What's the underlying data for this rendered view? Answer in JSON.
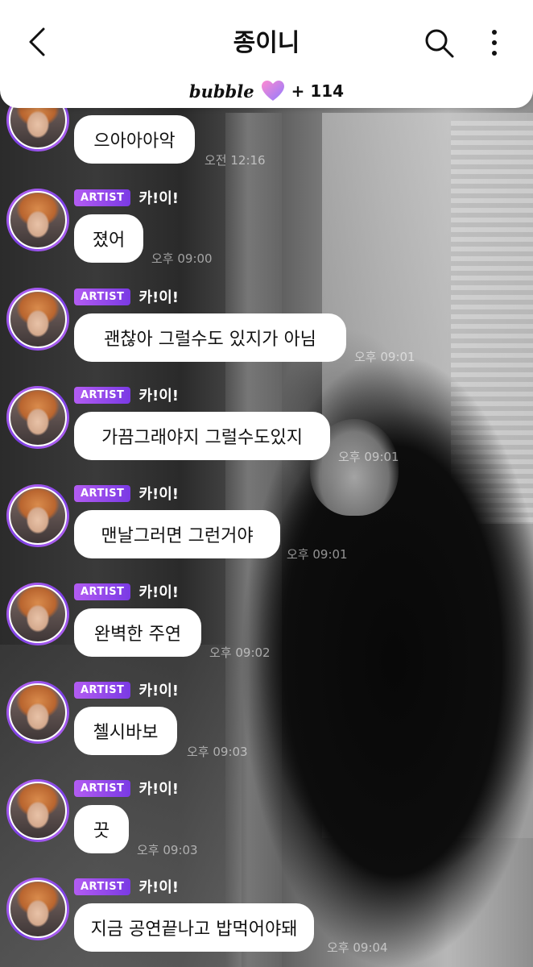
{
  "header": {
    "title": "종이니",
    "bubble_logo": "bubble",
    "bubble_count": "+ 114"
  },
  "messages": [
    {
      "badge": "",
      "name": "",
      "text": "으아아아악",
      "time": "오전 12:16"
    },
    {
      "badge": "ARTIST",
      "name": "카!이!",
      "text": "졌어",
      "time": "오후 09:00"
    },
    {
      "badge": "ARTIST",
      "name": "카!이!",
      "text": "괜찮아 그럴수도 있지가 아님",
      "time": "오후 09:01"
    },
    {
      "badge": "ARTIST",
      "name": "카!이!",
      "text": "가끔그래야지 그럴수도있지",
      "time": "오후 09:01"
    },
    {
      "badge": "ARTIST",
      "name": "카!이!",
      "text": "맨날그러면 그런거야",
      "time": "오후 09:01"
    },
    {
      "badge": "ARTIST",
      "name": "카!이!",
      "text": "완벽한 주연",
      "time": "오후 09:02"
    },
    {
      "badge": "ARTIST",
      "name": "카!이!",
      "text": "첼시바보",
      "time": "오후 09:03"
    },
    {
      "badge": "ARTIST",
      "name": "카!이!",
      "text": "끗",
      "time": "오후 09:03"
    },
    {
      "badge": "ARTIST",
      "name": "카!이!",
      "text": "지금 공연끝나고 밥먹어야돼",
      "time": "오후 09:04"
    }
  ],
  "colors": {
    "accent": "#7a3ae4",
    "badge_start": "#b35cf2",
    "heart_start": "#ff8ad0",
    "heart_end": "#8f7bff"
  }
}
